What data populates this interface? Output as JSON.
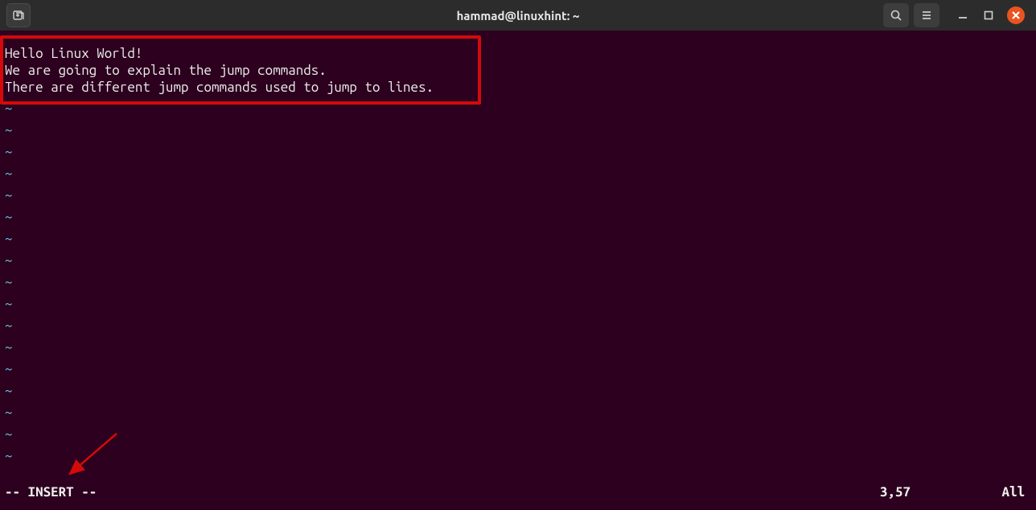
{
  "titlebar": {
    "title": "hammad@linuxhint: ~"
  },
  "editor": {
    "lines": [
      "Hello Linux World!",
      "We are going to explain the jump commands.",
      "There are different jump commands used to jump to lines."
    ],
    "tilde": "~"
  },
  "status": {
    "mode": "-- INSERT --",
    "position": "3,57",
    "percent": "All"
  }
}
